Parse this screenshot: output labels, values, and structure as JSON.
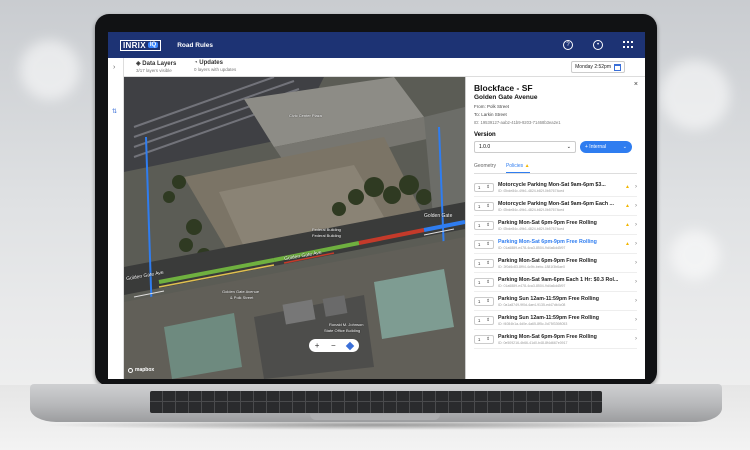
{
  "header": {
    "logo_text": "INRIX",
    "logo_badge": "IQ",
    "app_name": "Road Rules",
    "icons": [
      "help-icon",
      "account-icon",
      "apps-grid-icon"
    ]
  },
  "toolbar": {
    "data_layers_label": "Data Layers",
    "data_layers_sub": "3/17 layers visible",
    "updates_label": "Updates",
    "updates_sub": "0 layers with updates",
    "date_label": "Monday 2:52pm"
  },
  "map": {
    "labels": {
      "top_building": "Civic Center Plaza",
      "street_right": "Golden Gate",
      "street_left": "Golden Gate Ave",
      "street_mid": "Golden Gate Ave",
      "federal": "Federal Building",
      "federal2": "Federal Building",
      "ggap1": "Golden Gate Avenue",
      "ggap2": "& Polk Street",
      "johnson1": "Ronald M. Johnson",
      "johnson2": "State Office Building"
    },
    "controls": {
      "zoom_in": "+",
      "zoom_out": "−"
    },
    "attribution": "mapbox"
  },
  "panel": {
    "title": "Blockface - SF",
    "subtitle": "Golden Gate Avenue",
    "from": "From: Polk Street",
    "to": "To: Larkin Street",
    "id": "ID: 19539127-aab2-41b9-9203-71468b3ea2e1",
    "version_label": "Version",
    "version_value": "1.0.0",
    "internal_label": "+ Internal",
    "tabs": [
      "Geometry",
      "Policies"
    ],
    "policies": [
      {
        "qty": "1",
        "name": "Motorcycle Parking Mon-Sat 9am-6pm $3...",
        "id": "ID: f2bde84c-49b1-4824-b82f-0b57674ced",
        "warn": true,
        "highlight": false
      },
      {
        "qty": "1",
        "name": "Motorcycle Parking Mon-Sat 9am-6pm Each ...",
        "id": "ID: f2bde84c-49b1-4824-b82f-0b57674ced",
        "warn": true,
        "highlight": false
      },
      {
        "qty": "1",
        "name": "Parking Mon-Sat 6pm-9pm Free Rolling",
        "id": "ID: f2bde84c-49b1-4824-b82f-0b57674ced",
        "warn": true,
        "highlight": false
      },
      {
        "qty": "1",
        "name": "Parking Mon-Sat 6pm-9pm Free Rolling",
        "id": "ID: 01a6889-e478-4ca3-8504-9d4a6dd3f97",
        "warn": true,
        "highlight": true
      },
      {
        "qty": "1",
        "name": "Parking Mon-Sat 6pm-9pm Free Rolling",
        "id": "ID: 2f0d6c83-8f94-4c9b-bebc-1881f3b6ae0",
        "warn": false,
        "highlight": false
      },
      {
        "qty": "1",
        "name": "Parking Mon-Sat 9am-6pm Each 1 Hr: $0.3 Rol...",
        "id": "ID: 01a6889-e478-4ca3-8504-9d4a6dd3f97",
        "warn": false,
        "highlight": false
      },
      {
        "qty": "1",
        "name": "Parking Sun 12am-11:59pm Free Rolling",
        "id": "ID: 0a1a8749-9f0d-4ae4-9135-ed47db4c08",
        "warn": false,
        "highlight": false
      },
      {
        "qty": "1",
        "name": "Parking Sun 12am-11:59pm Free Rolling",
        "id": "ID: f4084b1a-4d0e-4a65-8f5c-0d75f3398053",
        "warn": false,
        "highlight": false
      },
      {
        "qty": "1",
        "name": "Parking Mon-Sat 6pm-9pm Free Rolling",
        "id": "ID: 0e509216-4b66-41d0-b48-8f4d667e0917",
        "warn": false,
        "highlight": false
      }
    ]
  },
  "colors": {
    "header_bg": "#1d3374",
    "accent": "#2f7df0",
    "warning": "#f2b600",
    "road_green": "#6fb03f",
    "road_red": "#c43a2a",
    "road_blue": "#2f7df0"
  }
}
